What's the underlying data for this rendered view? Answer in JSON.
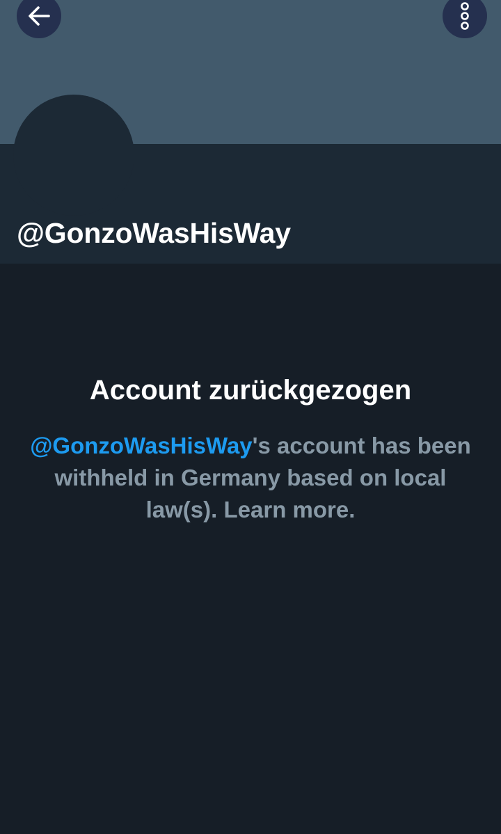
{
  "profile": {
    "handle": "@GonzoWasHisWay"
  },
  "toolbar": {
    "back_icon": "arrow-left-icon",
    "more_icon": "more-vertical-icon"
  },
  "notice": {
    "title": "Account zurückgezogen",
    "handle": "@GonzoWasHisWay",
    "body": "'s account has been withheld in Germany based on local law(s).",
    "link": "Learn more."
  },
  "colors": {
    "banner": "#425a6c",
    "header_panel": "#1c2935",
    "page_background": "#161e27",
    "button_background": "#25304f",
    "link_blue": "#1d9bf0",
    "secondary_text": "#8899a6"
  }
}
